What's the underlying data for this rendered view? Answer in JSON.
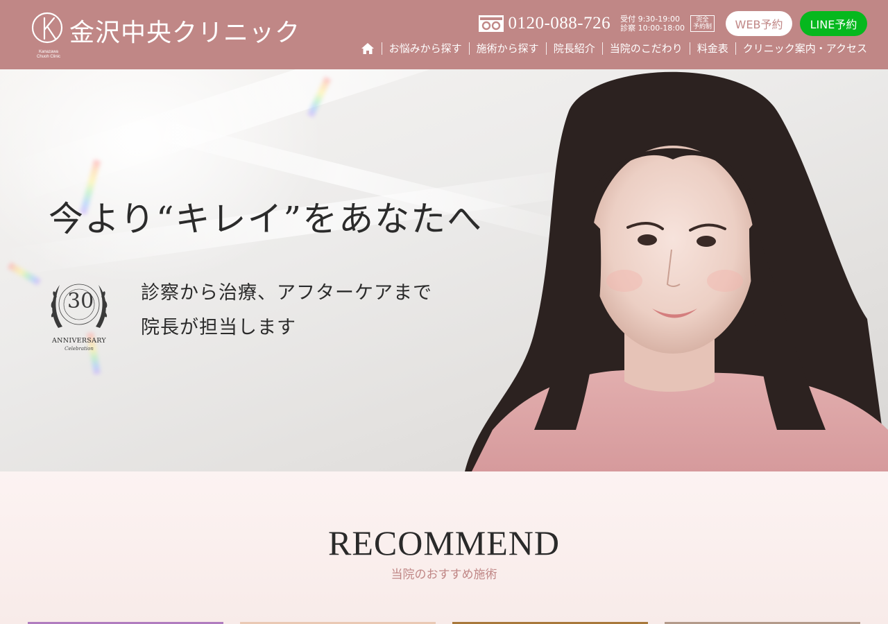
{
  "header": {
    "logo_mark": "K",
    "logo_sub_line1": "Kanazawa",
    "logo_sub_line2": "Chuoh Clinic",
    "clinic_name": "金沢中央クリニック",
    "phone": "0120-088-726",
    "hours_line1": "受付 9:30-19:00",
    "hours_line2": "診察 10:00-18:00",
    "reserve_badge_line1": "完全",
    "reserve_badge_line2": "予約制",
    "web_button": "WEB予約",
    "line_button": "LINE予約",
    "nav": [
      {
        "label": "お悩みから探す"
      },
      {
        "label": "施術から探す"
      },
      {
        "label": "院長紹介"
      },
      {
        "label": "当院のこだわり"
      },
      {
        "label": "料金表"
      },
      {
        "label": "クリニック案内・アクセス"
      }
    ],
    "colors": {
      "header_bg": "#c08786",
      "line_green": "#06b81e"
    }
  },
  "hero": {
    "title": "今より“キレイ”をあなたへ",
    "subtitle_line1": "診察から治療、アフターケアまで",
    "subtitle_line2": "院長が担当します",
    "badge_number": "30",
    "badge_text": "ANNIVERSARY",
    "badge_script": "Celebration",
    "badge_arc_top": "HAPPY ANNIVERSARY",
    "badge_arc_bottom": "YEARS CELEBRATION"
  },
  "recommend": {
    "title": "RECOMMEND",
    "subtitle": "当院のおすすめ施術",
    "card_colors": [
      "#b07cbf",
      "#eac9b4",
      "#a8783a",
      "#b39a8a"
    ]
  }
}
